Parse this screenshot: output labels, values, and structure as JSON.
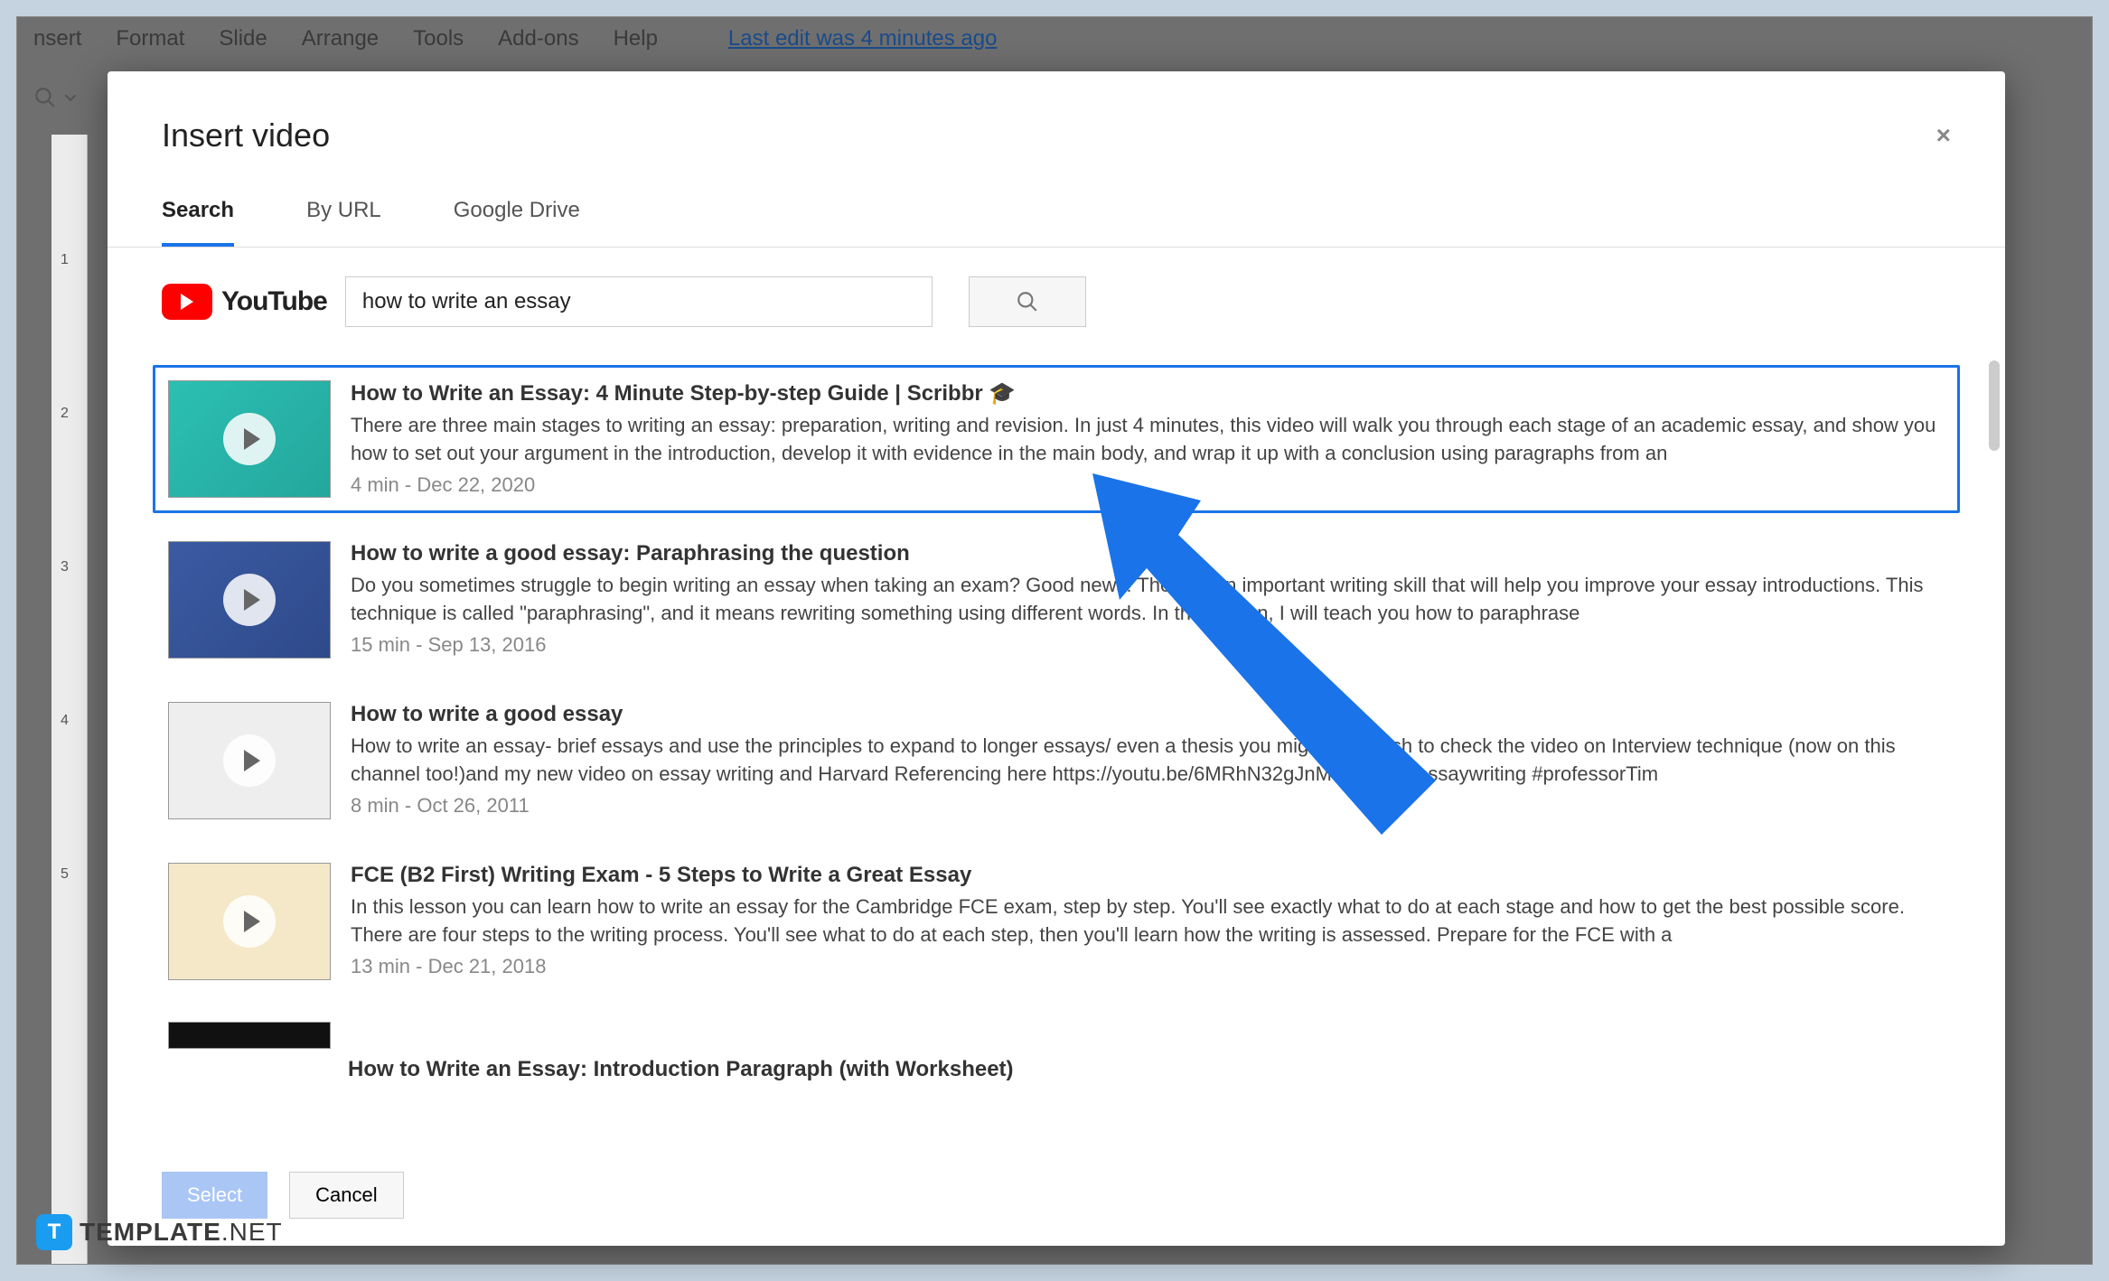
{
  "menu": {
    "items": [
      "nsert",
      "Format",
      "Slide",
      "Arrange",
      "Tools",
      "Add-ons",
      "Help"
    ],
    "last_edit": "Last edit was 4 minutes ago"
  },
  "ruler_ticks": [
    "",
    "1",
    "2",
    "3",
    "4",
    "5"
  ],
  "modal": {
    "title": "Insert video",
    "close": "×",
    "tabs": [
      {
        "label": "Search",
        "active": true
      },
      {
        "label": "By URL",
        "active": false
      },
      {
        "label": "Google Drive",
        "active": false
      }
    ],
    "youtube_label": "YouTube",
    "search_value": "how to write an essay",
    "results": [
      {
        "title": "How to Write an Essay: 4 Minute Step-by-step Guide | Scribbr 🎓",
        "desc": "There are three main stages to writing an essay: preparation, writing and revision. In just 4 minutes, this video will walk you through each stage of an academic essay, and show you how to set out your argument in the introduction, develop it with evidence in the main body, and wrap it up with a conclusion using paragraphs from an",
        "meta": "4 min - Dec 22, 2020",
        "selected": true,
        "thumb_class": "t1"
      },
      {
        "title": "How to write a good essay: Paraphrasing the question",
        "desc": "Do you sometimes struggle to begin writing an essay when taking an exam? Good news! There is an important writing skill that will help you improve your essay introductions. This technique is called \"paraphrasing\", and it means rewriting something using different words. In this lesson, I will teach you how to paraphrase",
        "meta": "15 min - Sep 13, 2016",
        "selected": false,
        "thumb_class": "t2"
      },
      {
        "title": "How to write a good essay",
        "desc": "How to write an essay- brief essays and use the principles to expand to longer essays/ even a thesis you might also wish to check the video on Interview technique (now on this channel too!)and my new video on essay writing and Harvard Referencing here https://youtu.be/6MRhN32gJnM #essay #essaywriting #professorTim",
        "meta": "8 min - Oct 26, 2011",
        "selected": false,
        "thumb_class": "t3"
      },
      {
        "title": "FCE (B2 First) Writing Exam - 5 Steps to Write a Great Essay",
        "desc": "In this lesson you can learn how to write an essay for the Cambridge FCE exam, step by step. You'll see exactly what to do at each stage and how to get the best possible score. There are four steps to the writing process. You'll see what to do at each step, then you'll learn how the writing is assessed. Prepare for the FCE with a",
        "meta": "13 min - Dec 21, 2018",
        "selected": false,
        "thumb_class": "t4"
      }
    ],
    "partial_result_title": "How to Write an Essay: Introduction Paragraph (with Worksheet)",
    "footer": {
      "select": "Select",
      "cancel": "Cancel"
    }
  },
  "watermark": {
    "badge": "T",
    "text1": "TEMPLATE",
    "text2": ".NET"
  }
}
